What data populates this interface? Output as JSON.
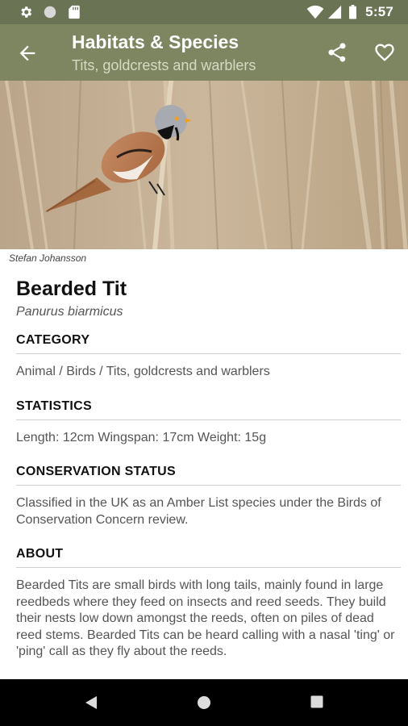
{
  "status_bar": {
    "time": "5:57",
    "left_icons": [
      "gear-icon",
      "circle-icon",
      "sd-card-icon"
    ],
    "right_icons": [
      "wifi-icon",
      "signal-icon",
      "battery-icon"
    ]
  },
  "app_bar": {
    "title": "Habitats & Species",
    "subtitle": "Tits, goldcrests and warblers",
    "back_icon": "arrow-back-icon",
    "actions": [
      "share-icon",
      "heart-outline-icon"
    ]
  },
  "hero": {
    "photo_credit": "Stefan Johansson"
  },
  "species": {
    "name": "Bearded Tit",
    "latin_name": "Panurus biarmicus"
  },
  "sections": {
    "category": {
      "heading": "CATEGORY",
      "text": "Animal / Birds / Tits, goldcrests and warblers"
    },
    "statistics": {
      "heading": "STATISTICS",
      "text": "Length: 12cm Wingspan: 17cm Weight: 15g"
    },
    "conservation": {
      "heading": "CONSERVATION STATUS",
      "text": "Classified in the UK as an Amber List species under the Birds of Conservation Concern review."
    },
    "about": {
      "heading": "ABOUT",
      "text": "Bearded Tits are small birds with long tails, mainly found in large reedbeds where they feed on insects and reed seeds. They build their nests low down amongst the reeds, often on piles of dead reed stems. Bearded Tits can be heard calling with a nasal 'ting' or 'ping' call as they fly about the reeds."
    }
  },
  "nav_bar": {
    "icons": [
      "nav-back-icon",
      "nav-home-icon",
      "nav-recents-icon"
    ]
  },
  "colors": {
    "status_bar": "#6b7355",
    "app_bar": "#7d8660",
    "subtitle": "#d6dac5",
    "divider": "#cfcfcf"
  }
}
